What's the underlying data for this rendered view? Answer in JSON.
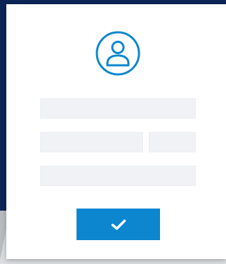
{
  "colors": {
    "backdrop": "#0c2556",
    "card": "#ffffff",
    "field": "#f1f2f5",
    "accent": "#0b86cf",
    "icon_stroke": "#0b86cf",
    "check": "#ffffff"
  },
  "icons": {
    "avatar": "user-circle-icon",
    "submit": "checkmark-icon"
  },
  "form": {
    "fields": [
      {
        "id": "field-1",
        "value": "",
        "placeholder": ""
      },
      {
        "id": "field-2",
        "value": "",
        "placeholder": ""
      },
      {
        "id": "field-3",
        "value": "",
        "placeholder": ""
      },
      {
        "id": "field-4",
        "value": "",
        "placeholder": ""
      }
    ]
  }
}
